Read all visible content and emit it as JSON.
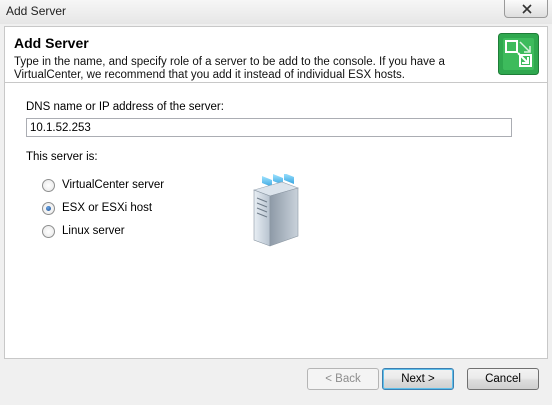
{
  "window": {
    "title": "Add Server"
  },
  "header": {
    "title": "Add Server",
    "description": "Type in the name, and specify role of a server to be add to the console. If you have a VirtualCenter, we recommend that you add it instead of individual ESX hosts."
  },
  "form": {
    "dns_label": "DNS name or IP address of the server:",
    "dns_value": "10.1.52.253",
    "role_label": "This server is:",
    "options": [
      {
        "label": "VirtualCenter server",
        "checked": false
      },
      {
        "label": "ESX or ESXi host",
        "checked": true
      },
      {
        "label": "Linux server",
        "checked": false
      }
    ]
  },
  "buttons": {
    "back": "< Back",
    "next": "Next >",
    "cancel": "Cancel"
  },
  "colors": {
    "accent_green": "#2fa84f"
  }
}
